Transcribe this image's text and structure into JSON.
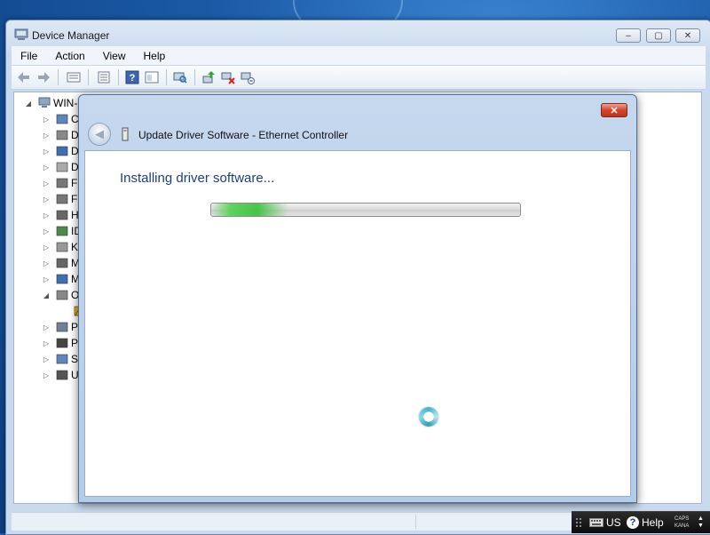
{
  "window": {
    "title": "Device Manager",
    "minimize_label": "‒",
    "maximize_label": "▢",
    "close_label": "✕"
  },
  "menu": {
    "items": [
      "File",
      "Action",
      "View",
      "Help"
    ]
  },
  "toolbar": {
    "buttons": [
      "back-icon",
      "forward-icon",
      "up-level-icon",
      "properties-icon",
      "help-icon",
      "view-icon",
      "scan-hardware-icon",
      "update-driver-icon",
      "uninstall-icon",
      "disable-icon"
    ]
  },
  "tree": {
    "root_label": "WIN-(",
    "nodes": [
      {
        "label": "Co",
        "icon": "computer-icon",
        "expanded": false
      },
      {
        "label": "Di",
        "icon": "disk-drive-icon",
        "expanded": false
      },
      {
        "label": "Di",
        "icon": "display-adapter-icon",
        "expanded": false
      },
      {
        "label": "DV",
        "icon": "dvd-drive-icon",
        "expanded": false
      },
      {
        "label": "Flo",
        "icon": "floppy-icon",
        "expanded": false
      },
      {
        "label": "Flo",
        "icon": "floppy-controller-icon",
        "expanded": false
      },
      {
        "label": "Hu",
        "icon": "hid-icon",
        "expanded": false
      },
      {
        "label": "ID",
        "icon": "ide-icon",
        "expanded": false
      },
      {
        "label": "Ke",
        "icon": "keyboard-icon",
        "expanded": false
      },
      {
        "label": "Mi",
        "icon": "mouse-icon",
        "expanded": false
      },
      {
        "label": "Mo",
        "icon": "monitor-icon",
        "expanded": false
      },
      {
        "label": "Ot",
        "icon": "other-devices-icon",
        "expanded": true
      },
      {
        "label": "",
        "icon": "warning-device-icon",
        "expanded": false
      },
      {
        "label": "Po",
        "icon": "port-icon",
        "expanded": false
      },
      {
        "label": "Pr",
        "icon": "processor-icon",
        "expanded": false
      },
      {
        "label": "Sy",
        "icon": "system-device-icon",
        "expanded": false
      },
      {
        "label": "Ur",
        "icon": "usb-icon",
        "expanded": false
      }
    ]
  },
  "dialog": {
    "title": "Update Driver Software - Ethernet Controller",
    "close_label": "✕",
    "heading": "Installing driver software...",
    "progress_fraction": 0.25,
    "status": "busy"
  },
  "tray": {
    "language": "US",
    "help_label": "Help",
    "caps_label": "CAPS",
    "kana_label": "KANA"
  },
  "colors": {
    "accent": "#1d3f7d",
    "progress": "#36c236",
    "close_button": "#d3452c"
  }
}
